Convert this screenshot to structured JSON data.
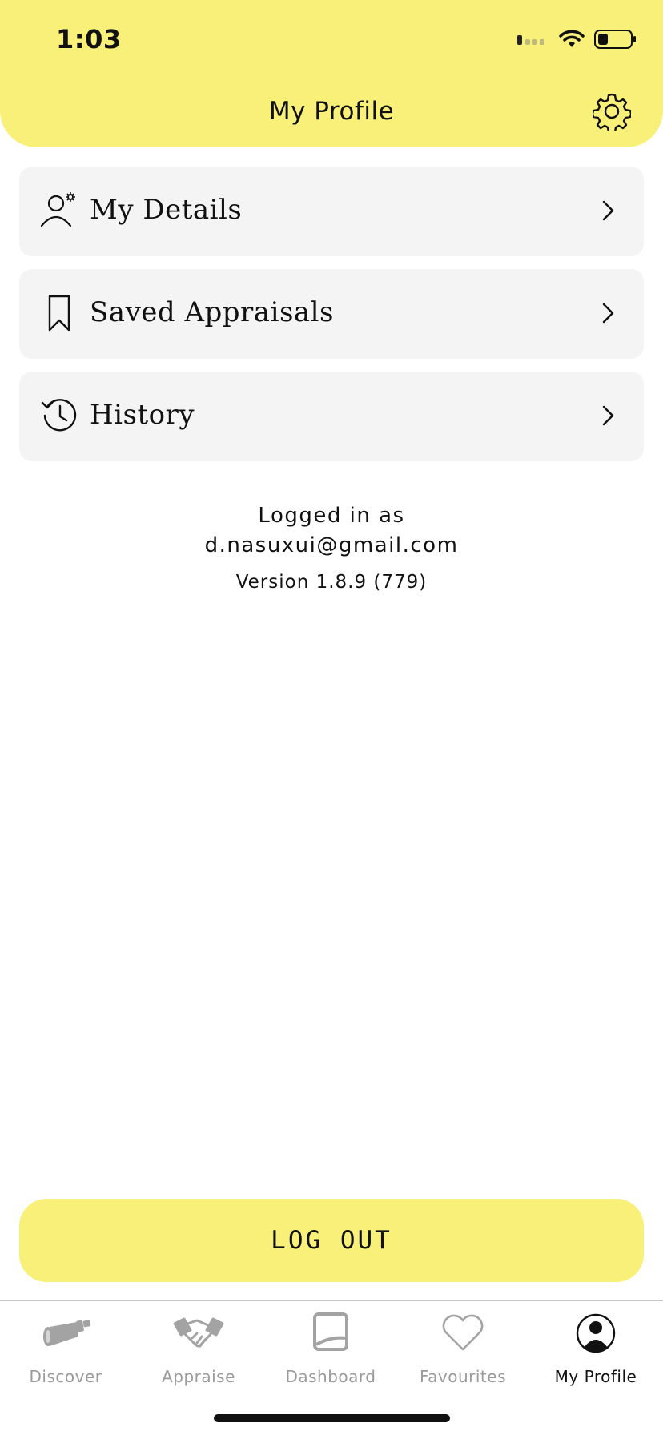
{
  "status_bar": {
    "time": "1:03"
  },
  "header": {
    "title": "My Profile",
    "settings_icon": "gear-icon"
  },
  "menu": [
    {
      "label": "My Details",
      "icon": "user-gear-icon"
    },
    {
      "label": "Saved Appraisals",
      "icon": "bookmark-icon"
    },
    {
      "label": "History",
      "icon": "history-icon"
    }
  ],
  "account": {
    "logged_in_label": "Logged in as",
    "email": "d.nasuxui@gmail.com",
    "version": "Version 1.8.9 (779)"
  },
  "logout_label": "LOG OUT",
  "tabs": [
    {
      "label": "Discover",
      "icon": "telescope-icon",
      "active": false
    },
    {
      "label": "Appraise",
      "icon": "handshake-icon",
      "active": false
    },
    {
      "label": "Dashboard",
      "icon": "dashboard-icon",
      "active": false
    },
    {
      "label": "Favourites",
      "icon": "heart-icon",
      "active": false
    },
    {
      "label": "My Profile",
      "icon": "profile-icon",
      "active": true
    }
  ],
  "colors": {
    "accent": "#f9f07a",
    "card": "#f4f4f4",
    "inactive": "#9a9a9a"
  }
}
